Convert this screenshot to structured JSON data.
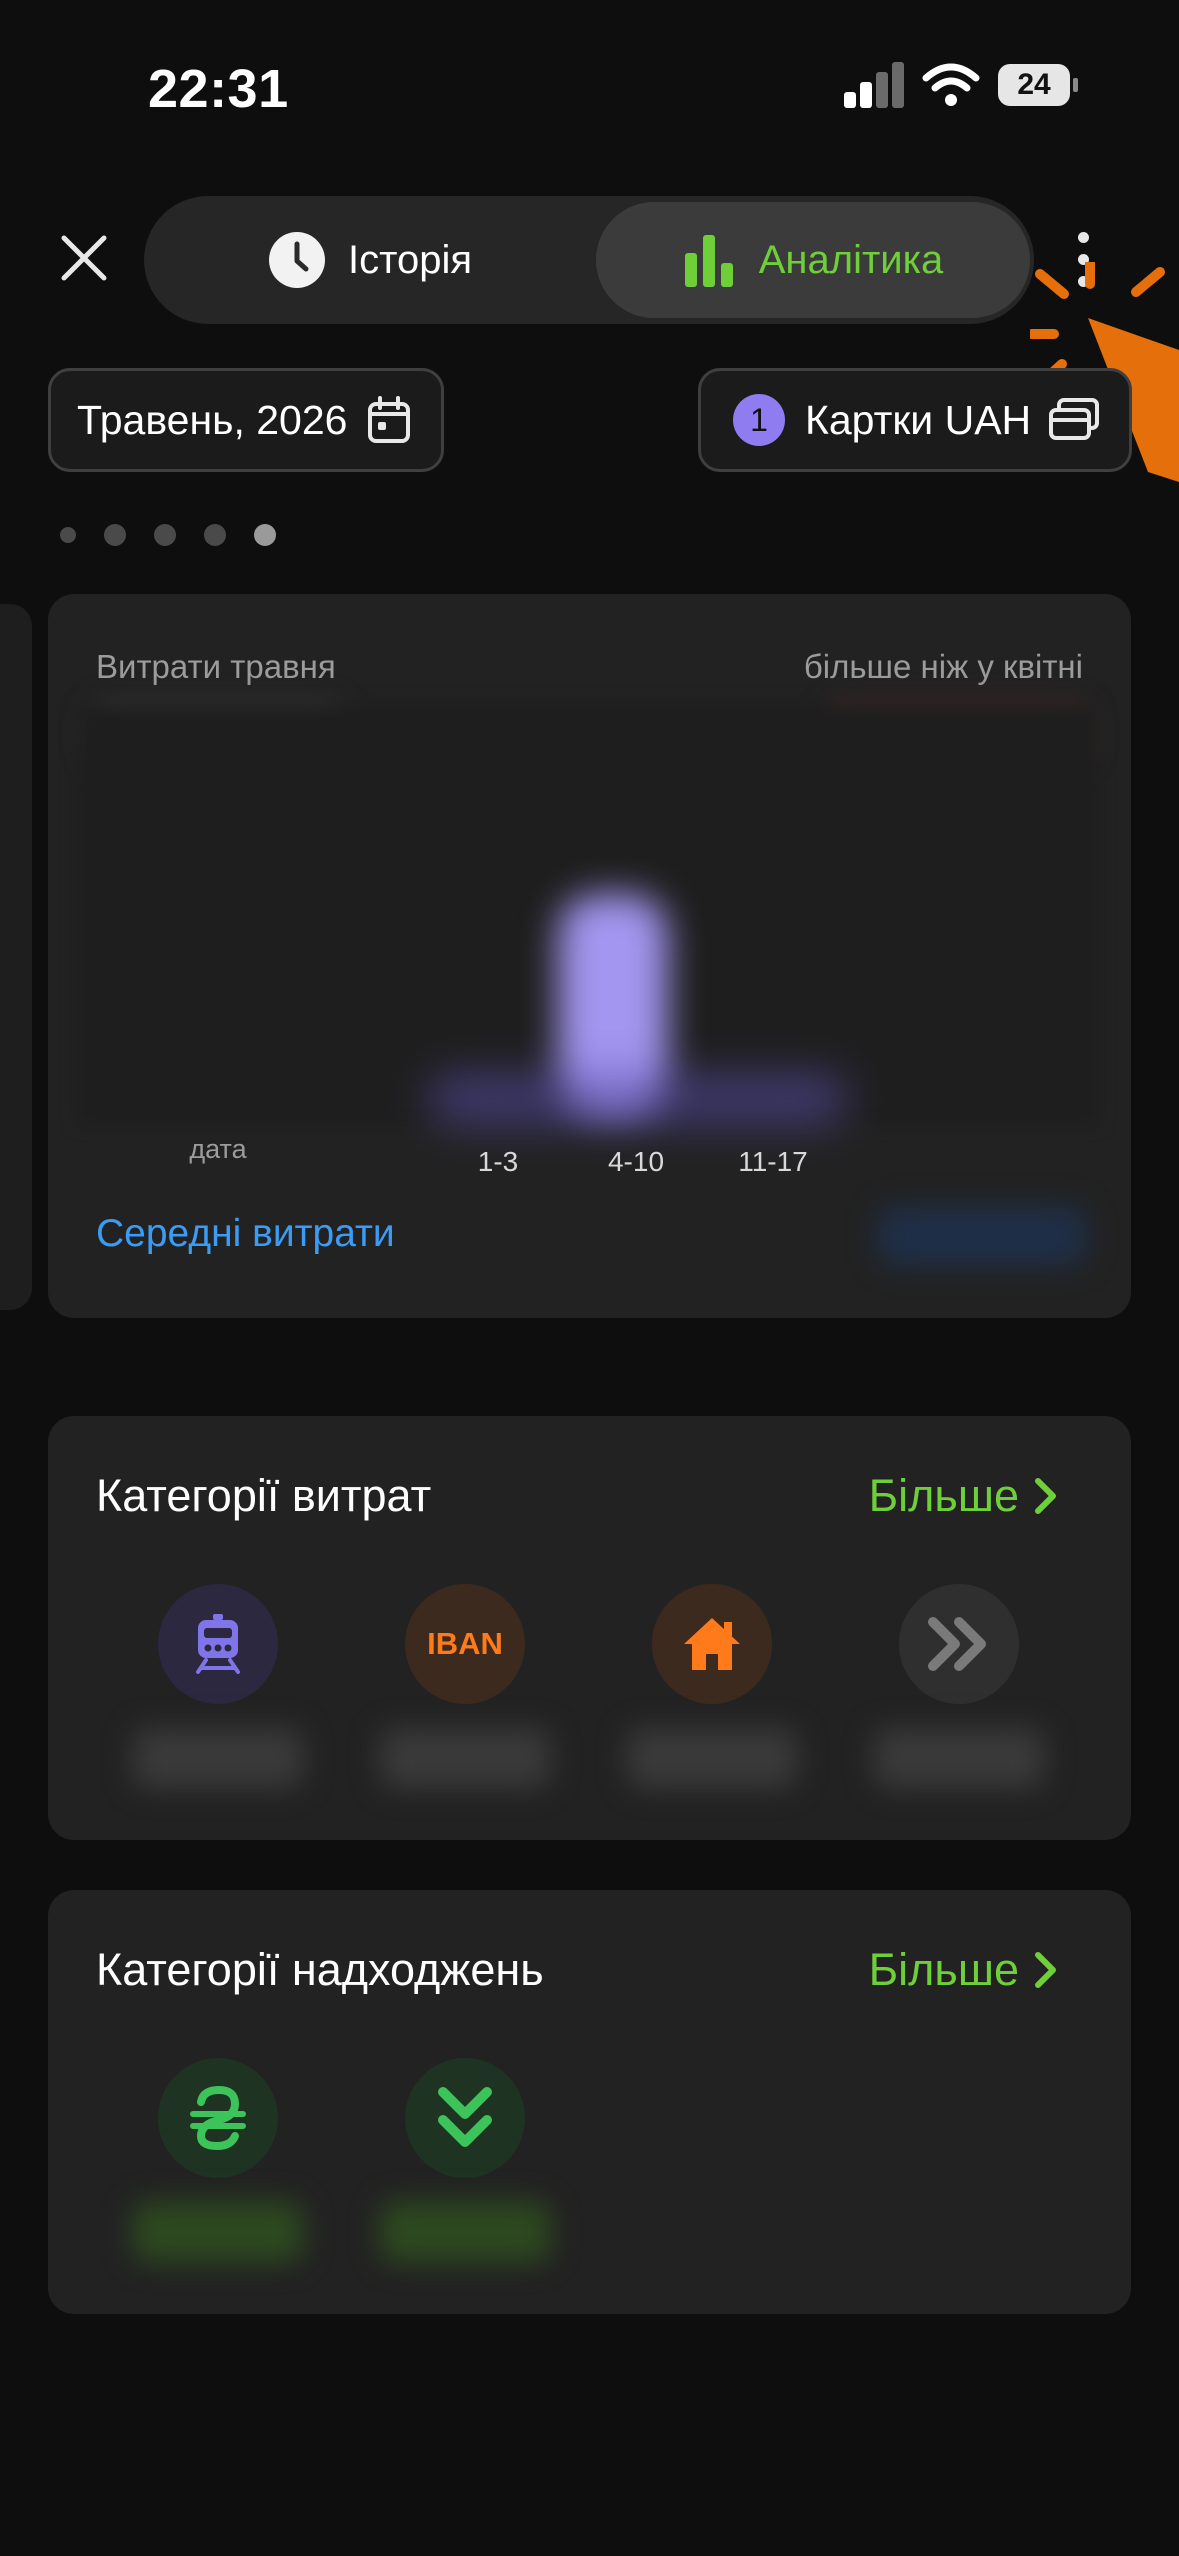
{
  "status_bar": {
    "time": "22:31",
    "battery": "24"
  },
  "tabs": [
    {
      "label": "Історія",
      "icon": "clock-icon",
      "active": false
    },
    {
      "label": "Аналітика",
      "icon": "bar-chart-icon",
      "active": true
    }
  ],
  "filters": {
    "period": "Травень, 2026",
    "cards_count": "1",
    "cards_label": "Картки UAH"
  },
  "pager": {
    "count": 5,
    "active_index": 4
  },
  "spending": {
    "title": "Витрати травня",
    "comparison": "більше ніж у квітні",
    "axis_label": "дата",
    "ticks": [
      "1-3",
      "4-10",
      "11-17"
    ],
    "average_link": "Середні витрати"
  },
  "expense_categories": {
    "title": "Категорії витрат",
    "more": "Більше",
    "items": [
      {
        "icon": "train-icon",
        "color": "#7f74e8",
        "bg": "#2b2840"
      },
      {
        "icon": "iban-icon",
        "text": "IBAN",
        "color": "#ff7a1a",
        "bg": "#3d2a1f"
      },
      {
        "icon": "house-icon",
        "color": "#ff7a1a",
        "bg": "#3d2a1f"
      },
      {
        "icon": "double-chevron-right-icon",
        "color": "#7a7a7a",
        "bg": "#2f2f2f"
      }
    ]
  },
  "income_categories": {
    "title": "Категорії надходжень",
    "more": "Більше",
    "items": [
      {
        "icon": "hryvnia-icon",
        "color": "#3cc35a",
        "bg": "#1f3322"
      },
      {
        "icon": "double-chevron-down-icon",
        "color": "#3cc35a",
        "bg": "#1f3322"
      }
    ]
  },
  "colors": {
    "accent_green": "#6fcf39",
    "accent_blue": "#3a9cf5",
    "accent_purple": "#8e7cf0"
  }
}
